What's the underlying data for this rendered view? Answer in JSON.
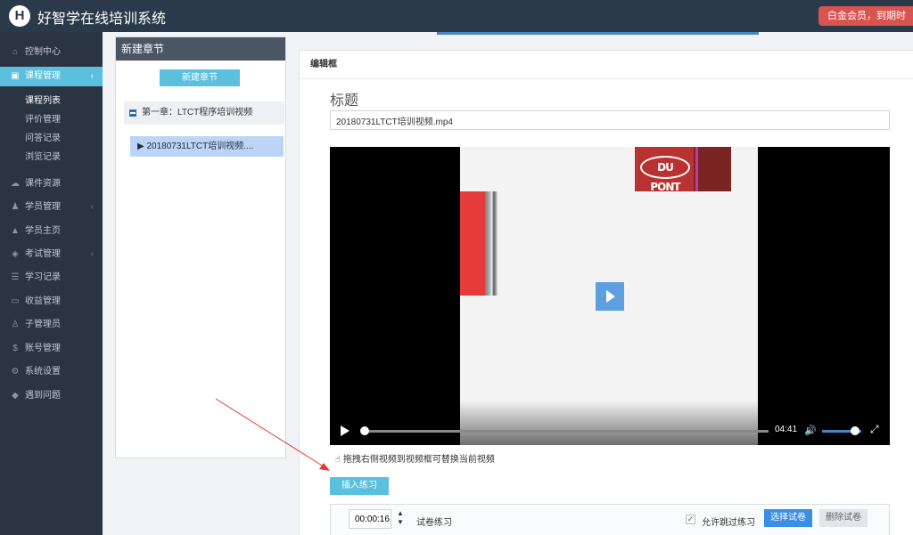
{
  "app": {
    "logo_letter": "H",
    "title": "好智学在线培训系统",
    "member_badge": "白金会员，到期时"
  },
  "sidebar": {
    "items": [
      {
        "label": "控制中心",
        "icon": "home-icon",
        "glyph": "⌂"
      },
      {
        "label": "课程管理",
        "icon": "book-icon",
        "glyph": "▣",
        "caret": "‹"
      },
      {
        "label": "课件资源",
        "icon": "cloud-icon",
        "glyph": "☁"
      },
      {
        "label": "学员管理",
        "icon": "users-icon",
        "glyph": "♟",
        "caret": "‹"
      },
      {
        "label": "学员主页",
        "icon": "graduation-cap-icon",
        "glyph": "▲"
      },
      {
        "label": "考试管理",
        "icon": "tag-icon",
        "glyph": "◈",
        "caret": "‹"
      },
      {
        "label": "学习记录",
        "icon": "list-icon",
        "glyph": "☰"
      },
      {
        "label": "收益管理",
        "icon": "credit-card-icon",
        "glyph": "▭"
      },
      {
        "label": "子管理员",
        "icon": "user-icon",
        "glyph": "♙"
      },
      {
        "label": "账号管理",
        "icon": "dollar-icon",
        "glyph": "$"
      },
      {
        "label": "系统设置",
        "icon": "gear-icon",
        "glyph": "⚙"
      },
      {
        "label": "遇到问题",
        "icon": "diamond-icon",
        "glyph": "◆"
      }
    ],
    "sub_items": [
      "课程列表",
      "评价管理",
      "问答记录",
      "浏览记录"
    ]
  },
  "chapter_panel": {
    "title": "新建章节",
    "new_button": "新建章节",
    "chapter_label": "第一章：LTCT程序培训视频",
    "video_item": "▶ 20180731LTCT培训视频...."
  },
  "editor": {
    "header": "编辑框",
    "title_label": "标题",
    "title_value": "20180731LTCT培训视频.mp4",
    "video": {
      "logo_text": "DU PONT",
      "time": "04:41",
      "progress": 0.0,
      "volume": 0.85
    },
    "hint_icon": "☝",
    "hint": "拖拽右侧视频到视频框可替换当前视频",
    "insert_button": "插入练习",
    "practice": {
      "time_value": "00:00:16",
      "exam_label": "试卷练习",
      "allow_skip_checked": true,
      "allow_skip_label": "允许跳过练习",
      "choose_button": "选择试卷",
      "delete_button": "删除试卷",
      "close": "X"
    }
  },
  "colors": {
    "accent": "#5bc0de",
    "sidebar": "#2b3542",
    "topbar": "#2b3a4a",
    "badge": "#d9534f",
    "annotation_arrow": "#e53935"
  }
}
